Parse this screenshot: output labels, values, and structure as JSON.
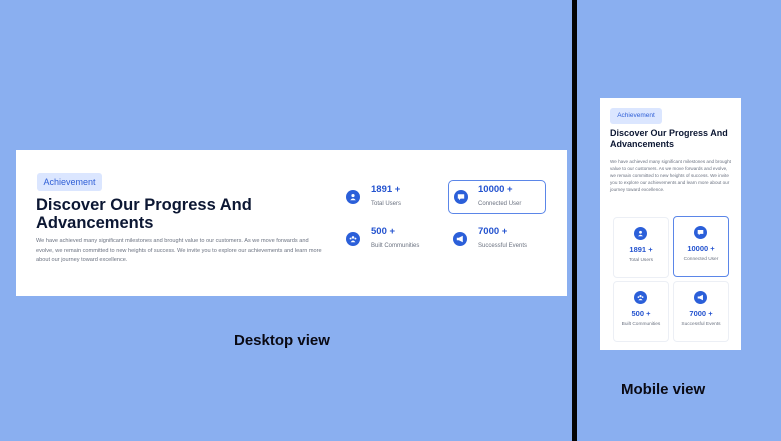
{
  "colors": {
    "background": "#8aaff0",
    "accent": "#2b5fd9",
    "card": "#ffffff"
  },
  "section": {
    "badge": "Achievement",
    "title": "Discover Our Progress And Advancements",
    "description": "We have achieved many significant milestones and brought value to our customers. As we move forwards and evolve, we remain committed to new heights of success. We invite you to explore our achievements and learn more about our journey toward excellence."
  },
  "mobile_section": {
    "description": "We have achieved many significant milestones and brought value to our customers. As we move forwards and evolve, we remain committed to new heights of success. We invite you to explore our achievements and learn more about our journey toward excellence."
  },
  "stats": [
    {
      "value": "1891 +",
      "label": "Total Users",
      "icon": "user-icon"
    },
    {
      "value": "10000 +",
      "label": "Connected User",
      "icon": "chat-icon"
    },
    {
      "value": "500 +",
      "label": "Built Communities",
      "icon": "community-icon"
    },
    {
      "value": "7000 +",
      "label": "Successful Events",
      "icon": "megaphone-icon"
    }
  ],
  "captions": {
    "desktop": "Desktop view",
    "mobile": "Mobile view"
  }
}
